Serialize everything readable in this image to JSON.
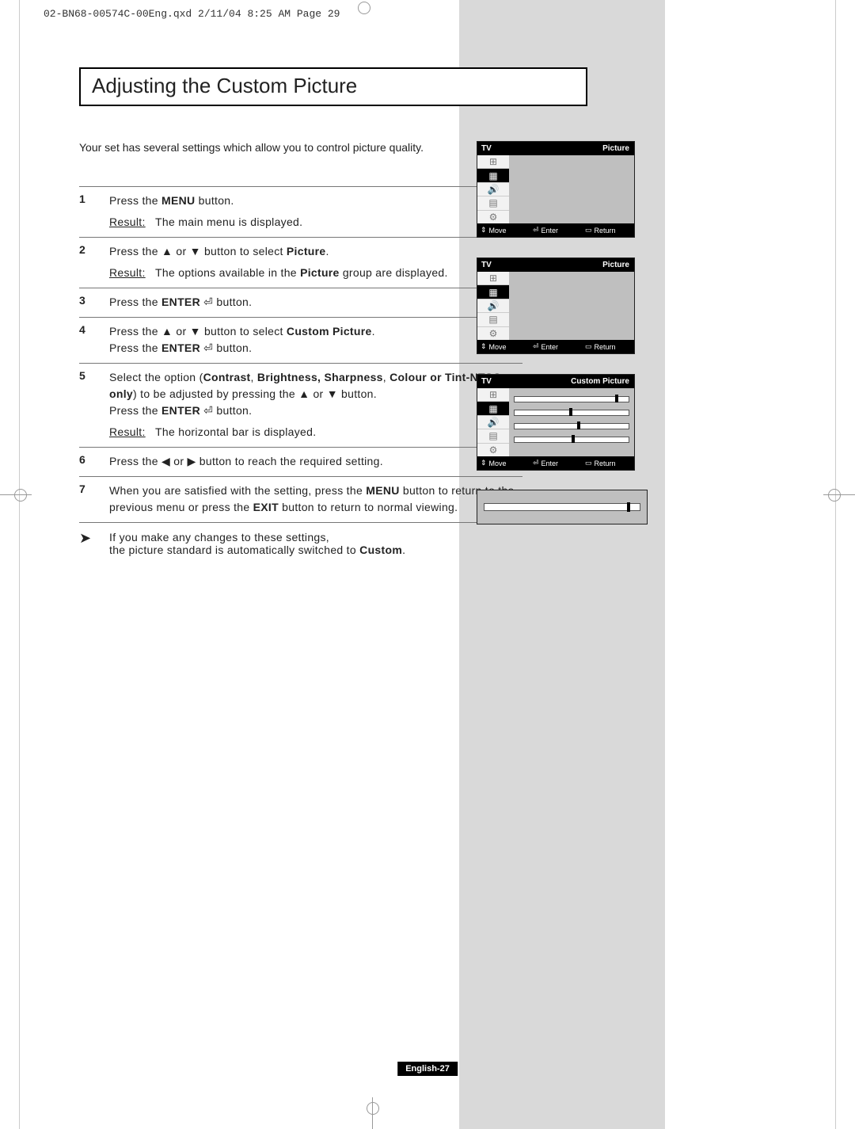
{
  "header": "02-BN68-00574C-00Eng.qxd  2/11/04 8:25 AM  Page 29",
  "title": "Adjusting the Custom Picture",
  "intro": "Your set has several settings which allow you to control picture quality.",
  "steps": [
    {
      "num": "1",
      "body_html": "Press the <b>MENU</b> button.",
      "result": "The main menu is displayed."
    },
    {
      "num": "2",
      "body_html": "Press the ▲ or ▼ button to select <b>Picture</b>.",
      "result": "The options available in the <b>Picture</b> group are displayed."
    },
    {
      "num": "3",
      "body_html": "Press the <b>ENTER</b> ⏎ button."
    },
    {
      "num": "4",
      "body_html": "Press the ▲ or ▼ button to select <b>Custom Picture</b>.<br>Press the <b>ENTER</b> ⏎ button."
    },
    {
      "num": "5",
      "body_html": "Select the option (<b>Contrast</b>, <b>Brightness,</b> <b>Sharpness</b>, <b>Colour or Tint-NTSC only</b>) to be adjusted by pressing the ▲ or ▼ button.<br>Press the <b>ENTER</b> ⏎ button.",
      "result": "The horizontal bar is displayed."
    },
    {
      "num": "6",
      "body_html": "Press the ◀ or ▶ button to reach the required setting."
    },
    {
      "num": "7",
      "body_html": "When you are satisfied with the setting, press the <b>MENU</b> button to return to the previous menu or press the <b>EXIT</b> button to return to normal viewing."
    }
  ],
  "note": "If you make any changes to these settings,<br>the picture standard is automatically switched to <b>Custom</b>.",
  "osd": {
    "tv": "TV",
    "picture": "Picture",
    "custom_picture": "Custom Picture",
    "move": "Move",
    "enter": "Enter",
    "return": "Return"
  },
  "page_number": "English-27"
}
